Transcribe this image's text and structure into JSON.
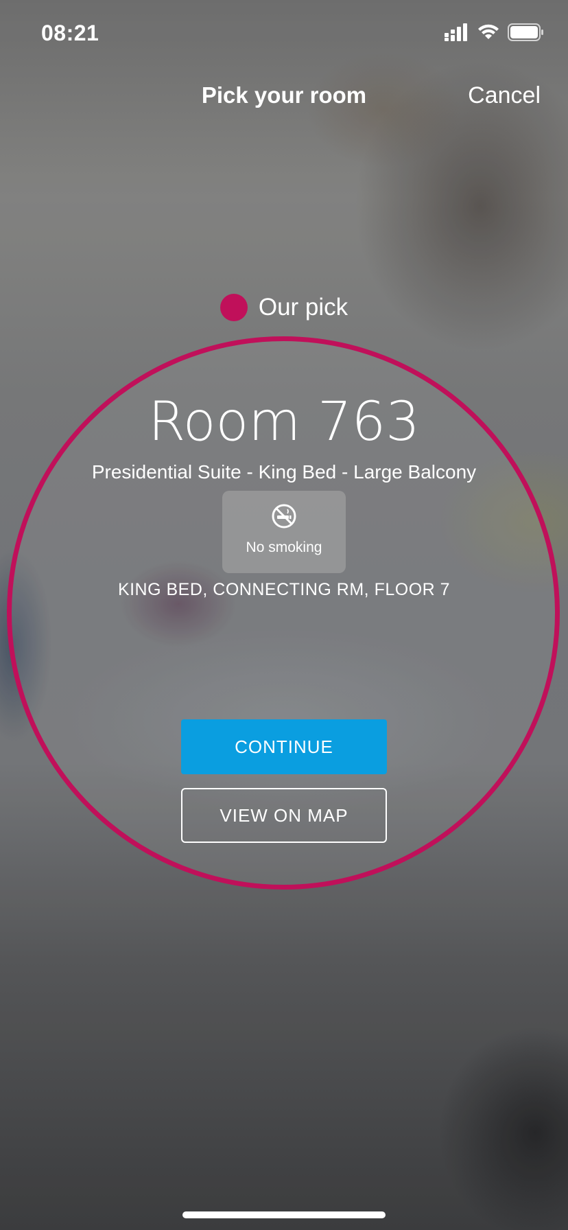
{
  "status_bar": {
    "time": "08:21",
    "icons": [
      "cellular-signal-icon",
      "wifi-icon",
      "battery-icon"
    ]
  },
  "nav": {
    "title": "Pick your room",
    "cancel_label": "Cancel"
  },
  "recommendation": {
    "label": "Our pick",
    "accent_color": "#c0105a"
  },
  "room": {
    "number": "Room 763",
    "type": "Presidential Suite - King Bed - Large Balcony",
    "badge": {
      "icon": "no-smoking-icon",
      "label": "No smoking"
    },
    "details": "KING BED, CONNECTING RM, FLOOR 7"
  },
  "actions": {
    "continue_label": "CONTINUE",
    "continue_color": "#0a9ee0",
    "map_label": "VIEW ON MAP"
  }
}
